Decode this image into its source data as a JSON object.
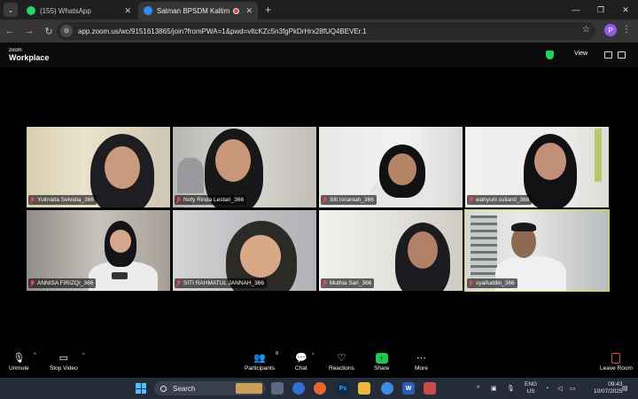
{
  "browser": {
    "tabs": [
      {
        "label": "(155) WhatsApp",
        "icon": "whatsapp-icon"
      },
      {
        "label": "Salman BPSDM Kaltim's Per",
        "icon": "zoom-icon",
        "recording": true
      }
    ],
    "url": "app.zoom.us/wc/9151613865/join?fromPWA=1&pwd=vltcKZc5n3fgPkDrHrx28fUQ4BEVEr.1",
    "profile_initial": "P"
  },
  "zoom": {
    "logo_top": "zoom",
    "logo": "Workplace",
    "view_label": "View"
  },
  "participants": [
    {
      "name": "Yulmaita Selvidia_366"
    },
    {
      "name": "Nofy Rinda Lestari_366"
    },
    {
      "name": "Siti Isnaniah_366"
    },
    {
      "name": "wahyuni sulianti_366"
    },
    {
      "name": "ANNISA FIRIZQI_366"
    },
    {
      "name": "SITI RAHMATUL JANNAH_366"
    },
    {
      "name": "Muthia Sari_366"
    },
    {
      "name": "syaifuddin_366",
      "active": true
    }
  ],
  "toolbar": {
    "unmute": "Unmute",
    "stop_video": "Stop Video",
    "participants": "Participants",
    "participants_count": "8",
    "chat": "Chat",
    "reactions": "Reactions",
    "share": "Share",
    "more": "More",
    "leave": "Leave Room"
  },
  "taskbar": {
    "search": "Search",
    "lang_line1": "ENG",
    "lang_line2": "US",
    "time": "09:43",
    "date": "10/07/2025"
  },
  "colors": {
    "accent_green": "#1dc954",
    "mute_red": "#e5484d",
    "active_speaker": "#c8d94a"
  }
}
